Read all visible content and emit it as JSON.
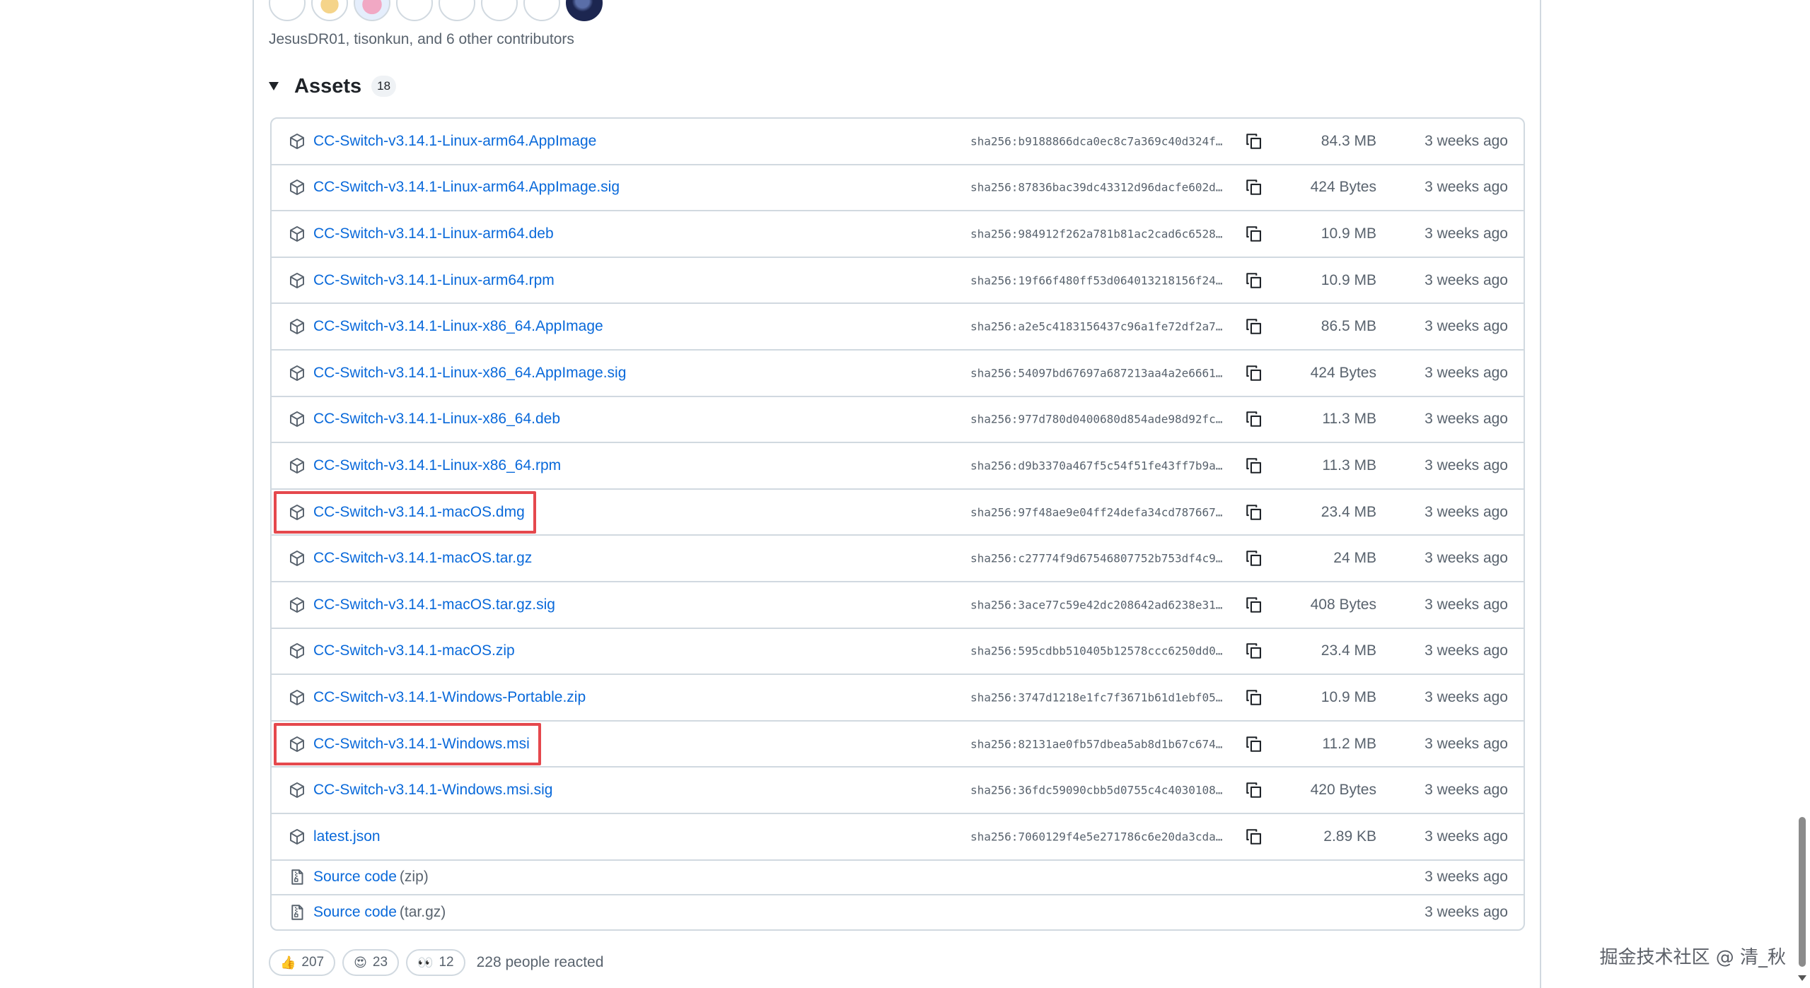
{
  "contributors": {
    "text": "JesusDR01, tisonkun, and 6 other contributors"
  },
  "assets": {
    "title": "Assets",
    "count": "18",
    "items": [
      {
        "name": "CC-Switch-v3.14.1-Linux-arm64.AppImage",
        "sha": "sha256:b9188866dca0ec8c7a369c40d324f…",
        "size": "84.3 MB",
        "time": "3 weeks ago"
      },
      {
        "name": "CC-Switch-v3.14.1-Linux-arm64.AppImage.sig",
        "sha": "sha256:87836bac39dc43312d96dacfe602d…",
        "size": "424 Bytes",
        "time": "3 weeks ago"
      },
      {
        "name": "CC-Switch-v3.14.1-Linux-arm64.deb",
        "sha": "sha256:984912f262a781b81ac2cad6c6528…",
        "size": "10.9 MB",
        "time": "3 weeks ago"
      },
      {
        "name": "CC-Switch-v3.14.1-Linux-arm64.rpm",
        "sha": "sha256:19f66f480ff53d064013218156f24…",
        "size": "10.9 MB",
        "time": "3 weeks ago"
      },
      {
        "name": "CC-Switch-v3.14.1-Linux-x86_64.AppImage",
        "sha": "sha256:a2e5c4183156437c96a1fe72df2a7…",
        "size": "86.5 MB",
        "time": "3 weeks ago"
      },
      {
        "name": "CC-Switch-v3.14.1-Linux-x86_64.AppImage.sig",
        "sha": "sha256:54097bd67697a687213aa4a2e6661…",
        "size": "424 Bytes",
        "time": "3 weeks ago"
      },
      {
        "name": "CC-Switch-v3.14.1-Linux-x86_64.deb",
        "sha": "sha256:977d780d0400680d854ade98d92fc…",
        "size": "11.3 MB",
        "time": "3 weeks ago"
      },
      {
        "name": "CC-Switch-v3.14.1-Linux-x86_64.rpm",
        "sha": "sha256:d9b3370a467f5c54f51fe43ff7b9a…",
        "size": "11.3 MB",
        "time": "3 weeks ago"
      },
      {
        "name": "CC-Switch-v3.14.1-macOS.dmg",
        "sha": "sha256:97f48ae9e04ff24defa34cd787667…",
        "size": "23.4 MB",
        "time": "3 weeks ago",
        "highlighted": true
      },
      {
        "name": "CC-Switch-v3.14.1-macOS.tar.gz",
        "sha": "sha256:c27774f9d67546807752b753df4c9…",
        "size": "24 MB",
        "time": "3 weeks ago"
      },
      {
        "name": "CC-Switch-v3.14.1-macOS.tar.gz.sig",
        "sha": "sha256:3ace77c59e42dc208642ad6238e31…",
        "size": "408 Bytes",
        "time": "3 weeks ago"
      },
      {
        "name": "CC-Switch-v3.14.1-macOS.zip",
        "sha": "sha256:595cdbb510405b12578ccc6250dd0…",
        "size": "23.4 MB",
        "time": "3 weeks ago"
      },
      {
        "name": "CC-Switch-v3.14.1-Windows-Portable.zip",
        "sha": "sha256:3747d1218e1fc7f3671b61d1ebf05…",
        "size": "10.9 MB",
        "time": "3 weeks ago"
      },
      {
        "name": "CC-Switch-v3.14.1-Windows.msi",
        "sha": "sha256:82131ae0fb57dbea5ab8d1b67c674…",
        "size": "11.2 MB",
        "time": "3 weeks ago",
        "highlighted": true
      },
      {
        "name": "CC-Switch-v3.14.1-Windows.msi.sig",
        "sha": "sha256:36fdc59090cbb5d0755c4c4030108…",
        "size": "420 Bytes",
        "time": "3 weeks ago"
      },
      {
        "name": "latest.json",
        "sha": "sha256:7060129f4e5e271786c6e20da3cda…",
        "size": "2.89 KB",
        "time": "3 weeks ago"
      }
    ],
    "source": [
      {
        "name": "Source code",
        "format": "(zip)",
        "time": "3 weeks ago"
      },
      {
        "name": "Source code",
        "format": "(tar.gz)",
        "time": "3 weeks ago"
      }
    ]
  },
  "reactions": {
    "items": [
      {
        "emoji": "👍",
        "count": "207"
      },
      {
        "emoji": "😍",
        "count": "23"
      },
      {
        "emoji": "👀",
        "count": "12"
      }
    ],
    "summary": "228 people reacted"
  },
  "watermark": "掘金技术社区 @ 清_秋",
  "colors": {
    "link": "#0969da",
    "muted": "#59636e",
    "border": "#d1d9e0",
    "highlight": "#e5484d"
  }
}
